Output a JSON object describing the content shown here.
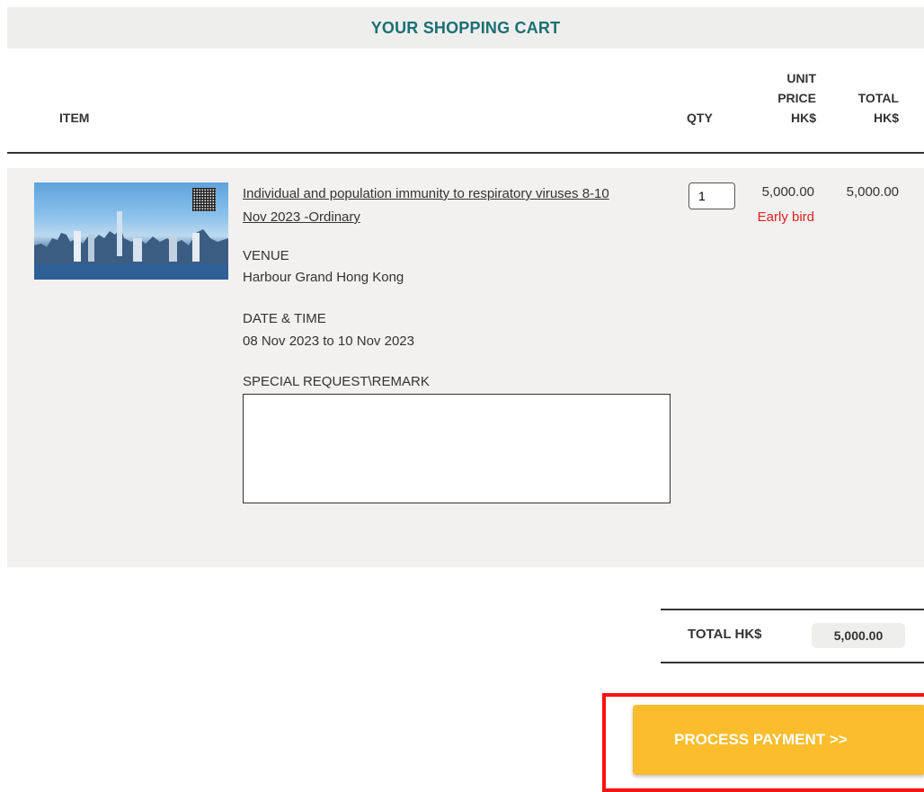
{
  "cart": {
    "title": "YOUR SHOPPING CART",
    "headers": {
      "item": "ITEM",
      "qty": "QTY",
      "unit_price": "UNIT\nPRICE\nHK$",
      "total": "TOTAL\nHK$"
    },
    "item": {
      "name": "Individual and population immunity to respiratory viruses 8-10 Nov 2023 -Ordinary",
      "venue_label": "VENUE",
      "venue": "Harbour Grand Hong Kong",
      "date_label": "DATE & TIME",
      "date": "08 Nov 2023 to 10 Nov 2023",
      "remark_label": "SPECIAL REQUEST\\REMARK",
      "remark_value": "",
      "quantity": "1",
      "unit_price": "5,000.00",
      "price_tier": "Early bird",
      "line_total": "5,000.00"
    },
    "summary": {
      "total_label": "TOTAL HK$",
      "total_value": "5,000.00"
    },
    "actions": {
      "pay_label": "PROCESS PAYMENT >>"
    }
  },
  "colors": {
    "title_text": "#1b6f74",
    "header_bg": "#eeeeed",
    "panel_bg": "#f2f1ef",
    "early_bird": "#e02020",
    "pay_button": "#fbbd2c",
    "highlight": "#ff1010"
  },
  "icons": [
    "event-thumbnail-image",
    "qr-code-icon"
  ]
}
